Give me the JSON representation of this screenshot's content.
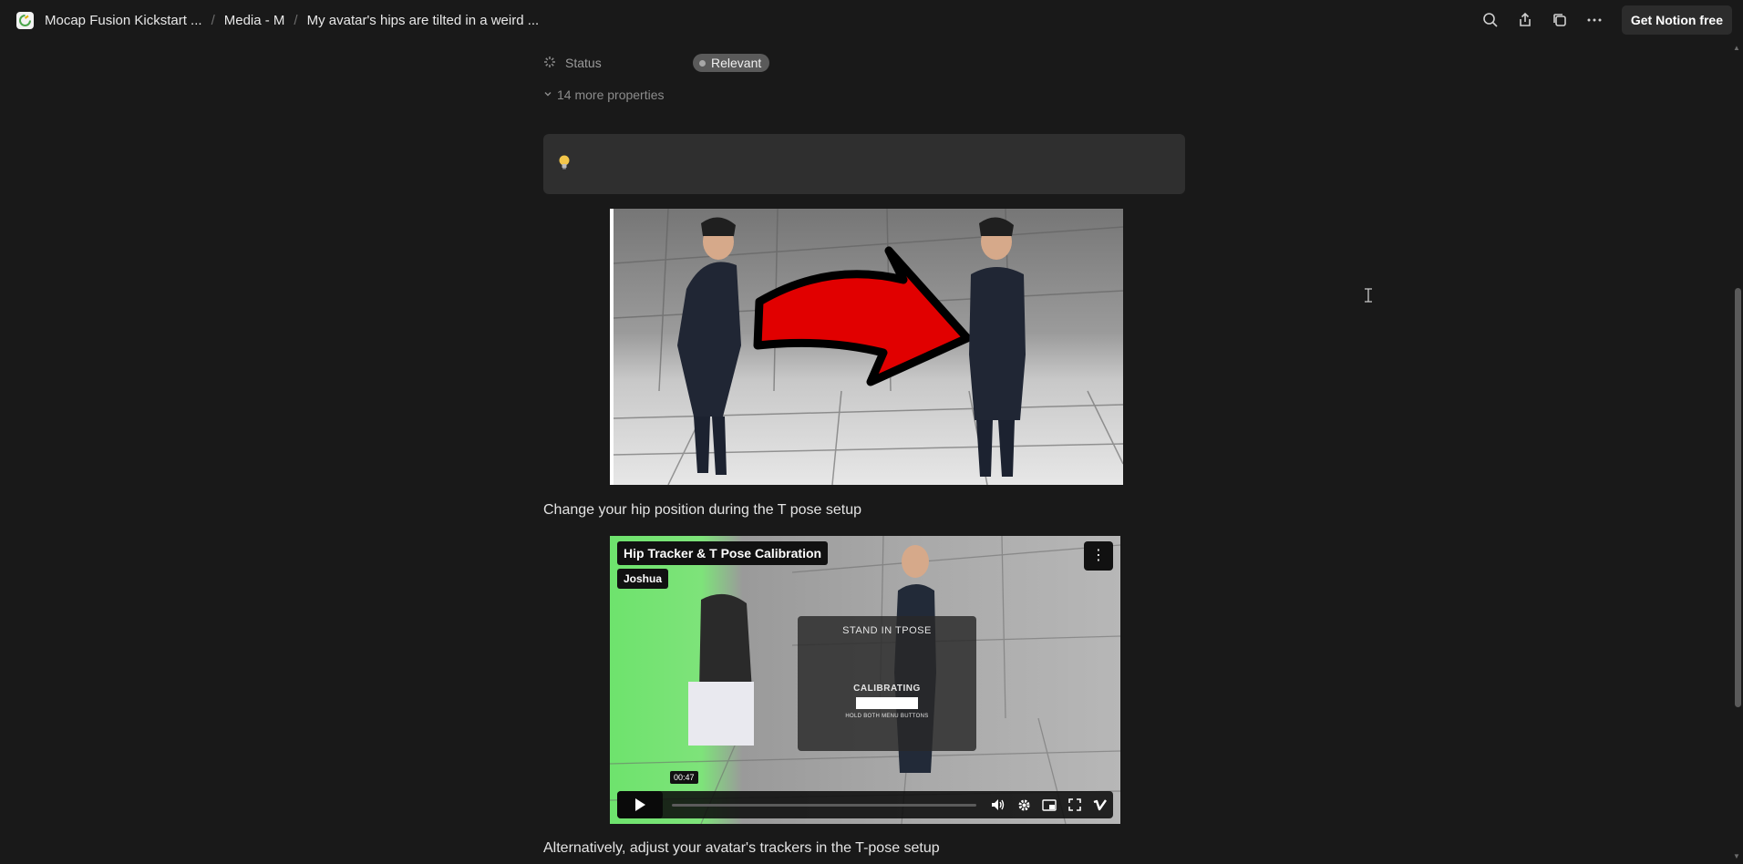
{
  "breadcrumb": {
    "workspace": "Mocap Fusion Kickstart ...",
    "section": "Media - M",
    "page": "My avatar's hips are tilted in a weird ..."
  },
  "toolbar": {
    "get_notion_label": "Get Notion free"
  },
  "properties": {
    "status_label": "Status",
    "status_value": "Relevant",
    "more_label": "14 more properties"
  },
  "blocks": {
    "caption1": "Change your hip position during the T pose setup",
    "caption2": "Alternatively, adjust your avatar's trackers in the T-pose setup"
  },
  "video": {
    "title": "Hip Tracker & T Pose Calibration",
    "author": "Joshua",
    "overlay_top": "STAND IN TPOSE",
    "overlay_middle": "CALIBRATING",
    "overlay_bottom": "HOLD BOTH MENU BUTTONS",
    "timestamp": "00:47"
  },
  "colors": {
    "background": "#191919",
    "callout_bg": "#2f2f2f",
    "badge_bg": "#5a5a5a",
    "text": "#e3e3e3"
  }
}
